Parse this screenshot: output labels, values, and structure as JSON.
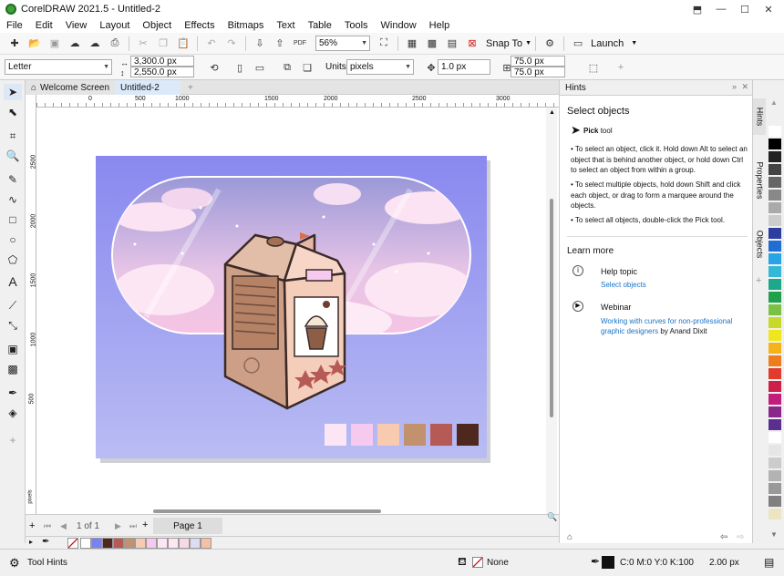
{
  "window": {
    "title": "CorelDRAW 2021.5 - Untitled-2"
  },
  "menu": [
    "File",
    "Edit",
    "View",
    "Layout",
    "Object",
    "Effects",
    "Bitmaps",
    "Text",
    "Table",
    "Tools",
    "Window",
    "Help"
  ],
  "toolbar": {
    "zoom": "56%",
    "snap_to": "Snap To",
    "launch": "Launch"
  },
  "propbar": {
    "page_size": "Letter",
    "width": "3,300.0 px",
    "height": "2,550.0 px",
    "units_label": "Units:",
    "units": "pixels",
    "nudge": "1.0 px",
    "dup_x": "75.0 px",
    "dup_y": "75.0 px"
  },
  "tabs": {
    "welcome": "Welcome Screen",
    "doc": "Untitled-2"
  },
  "ruler": {
    "h": [
      "0",
      "500",
      "1000",
      "1500",
      "2000",
      "2500",
      "3000"
    ],
    "v": [
      "2500",
      "2000",
      "1500",
      "1000",
      "500"
    ],
    "units": "pixels"
  },
  "artwork": {
    "background": "#8d8cf0",
    "swatches": [
      "#fce6f5",
      "#f6c9ee",
      "#f8cab0",
      "#c1926d",
      "#b65a56",
      "#4e271e"
    ]
  },
  "pager": {
    "current": "1",
    "of": "of",
    "total": "1",
    "page_tab": "Page 1"
  },
  "doc_palette": [
    "#ffffff",
    "#7a82f2",
    "#4e271e",
    "#b65a56",
    "#c1926d",
    "#f8cab0",
    "#f6c9ee",
    "#fce6f5",
    "#fde8f1",
    "#f7d9e6",
    "#dcdcf2",
    "#f5c0a5"
  ],
  "status": {
    "tool_hints": "Tool Hints",
    "fill": "None",
    "outline_color": "C:0 M:0 Y:0 K:100",
    "outline_width": "2.00 px"
  },
  "hints": {
    "title": "Hints",
    "heading": "Select objects",
    "tool_name": "Pick",
    "tool_word": "tool",
    "bullets": [
      "To select an object, click it. Hold down Alt to select an object that is behind another object, or hold down Ctrl to select an object from within a group.",
      "To select multiple objects, hold down Shift and click each object, or drag to form a marquee around the objects.",
      "To select all objects, double-click the Pick tool."
    ],
    "learn_more": "Learn more",
    "help_topic_label": "Help topic",
    "help_topic_link": "Select objects",
    "webinar_label": "Webinar",
    "webinar_link": "Working with curves for non-professional graphic designers",
    "webinar_author": "by Anand Dixit"
  },
  "docker_tabs": [
    "Hints",
    "Properties",
    "Objects"
  ],
  "right_palette": [
    "#ffffff",
    "#000000",
    "#222222",
    "#444444",
    "#666666",
    "#888888",
    "#aaaaaa",
    "#cccccc",
    "#2d3e9f",
    "#1f6ed4",
    "#27a3e8",
    "#33b8d6",
    "#1ca88b",
    "#21a04b",
    "#7bc143",
    "#c8d92a",
    "#f1e51d",
    "#f6b219",
    "#ee7d1d",
    "#e23a2b",
    "#cd1f49",
    "#c21d7c",
    "#8a2889",
    "#5b2f90",
    "#ffffff",
    "#e6e6e6",
    "#cccccc",
    "#b3b3b3",
    "#999999",
    "#808080",
    "#ebe5c2"
  ],
  "colors": {
    "accent": "#1a73c8",
    "menu_bg": "#ffffff",
    "chrome": "#f0f0f0"
  }
}
